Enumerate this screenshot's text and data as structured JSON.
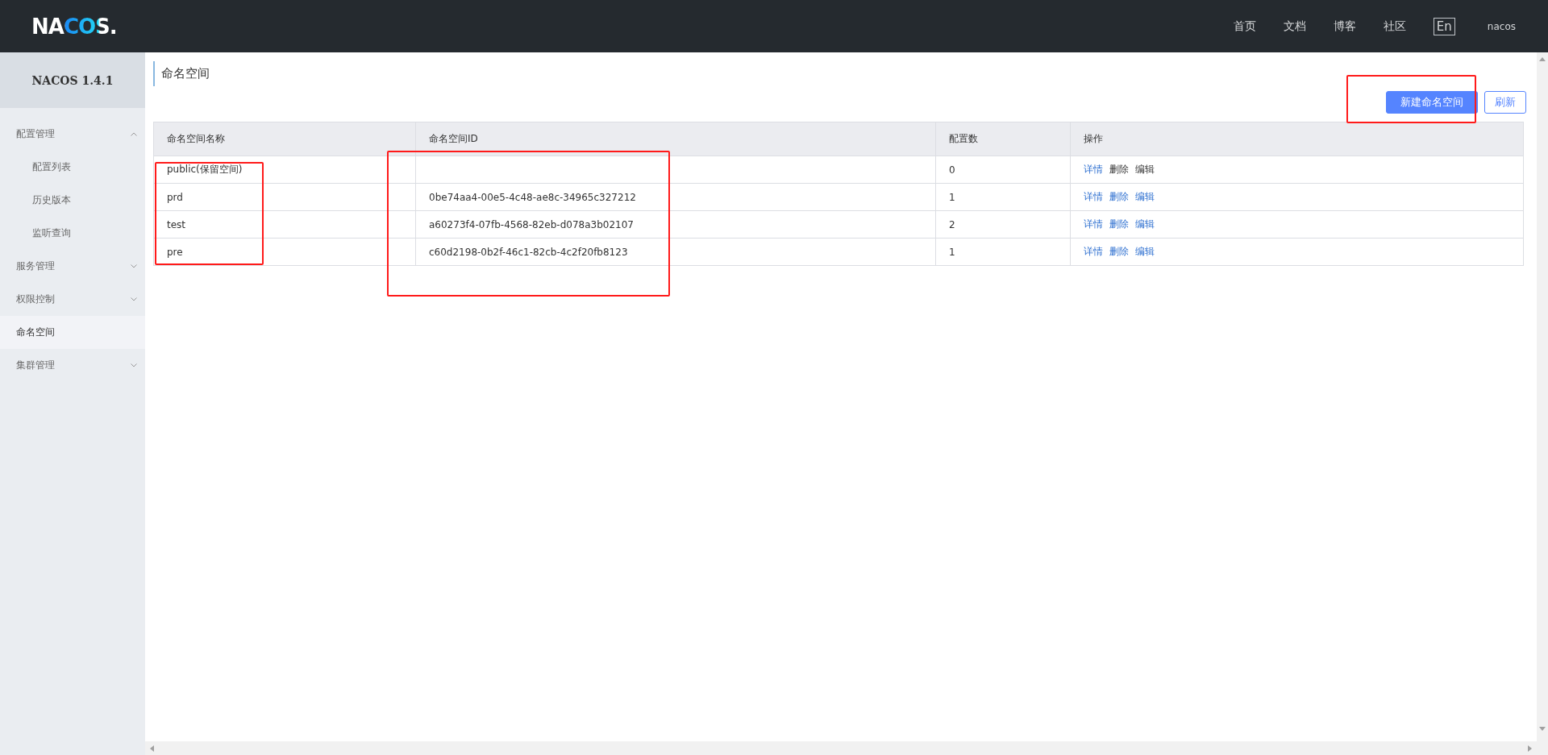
{
  "header": {
    "logo": "NACOS.",
    "nav": [
      {
        "label": "首页"
      },
      {
        "label": "文档"
      },
      {
        "label": "博客"
      },
      {
        "label": "社区"
      }
    ],
    "language": "En",
    "user": "nacos"
  },
  "sidebar": {
    "title": "NACOS 1.4.1",
    "items": [
      {
        "label": "配置管理",
        "expanded": true,
        "selected": false,
        "children": [
          {
            "label": "配置列表",
            "selected": false
          },
          {
            "label": "历史版本",
            "selected": false
          },
          {
            "label": "监听查询",
            "selected": false
          }
        ]
      },
      {
        "label": "服务管理",
        "expanded": false,
        "selected": false
      },
      {
        "label": "权限控制",
        "expanded": false,
        "selected": false
      },
      {
        "label": "命名空间",
        "selected": true
      },
      {
        "label": "集群管理",
        "expanded": false,
        "selected": false
      }
    ]
  },
  "page": {
    "title": "命名空间",
    "buttons": [
      {
        "label": "新建命名空间",
        "kind": "primary"
      },
      {
        "label": "刷新",
        "kind": "secondary"
      }
    ]
  },
  "table": {
    "columns": [
      "命名空间名称",
      "命名空间ID",
      "配置数",
      "操作"
    ],
    "rows": [
      {
        "name": "public(保留空间)",
        "id": "",
        "count": "0",
        "actions": [
          {
            "label": "详情",
            "disabled": false
          },
          {
            "label": "删除",
            "disabled": true
          },
          {
            "label": "编辑",
            "disabled": true
          }
        ]
      },
      {
        "name": "prd",
        "id": "0be74aa4-00e5-4c48-ae8c-34965c327212",
        "count": "1",
        "actions": [
          {
            "label": "详情",
            "disabled": false
          },
          {
            "label": "删除",
            "disabled": false
          },
          {
            "label": "编辑",
            "disabled": false
          }
        ]
      },
      {
        "name": "test",
        "id": "a60273f4-07fb-4568-82eb-d078a3b02107",
        "count": "2",
        "actions": [
          {
            "label": "详情",
            "disabled": false
          },
          {
            "label": "删除",
            "disabled": false
          },
          {
            "label": "编辑",
            "disabled": false
          }
        ]
      },
      {
        "name": "pre",
        "id": "c60d2198-0b2f-46c1-82cb-4c2f20fb8123",
        "count": "1",
        "actions": [
          {
            "label": "详情",
            "disabled": false
          },
          {
            "label": "删除",
            "disabled": false
          },
          {
            "label": "编辑",
            "disabled": false
          }
        ]
      }
    ]
  }
}
